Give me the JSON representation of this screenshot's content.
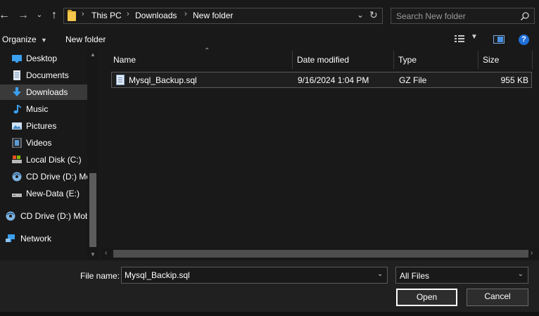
{
  "address": {
    "crumbs": [
      "This PC",
      "Downloads",
      "New folder"
    ],
    "search_placeholder": "Search New folder"
  },
  "toolbar": {
    "organize_label": "Organize",
    "new_folder_label": "New folder"
  },
  "nav": {
    "items": [
      {
        "label": "Desktop",
        "icon": "desktop-icon"
      },
      {
        "label": "Documents",
        "icon": "documents-icon"
      },
      {
        "label": "Downloads",
        "icon": "downloads-icon",
        "selected": true
      },
      {
        "label": "Music",
        "icon": "music-icon"
      },
      {
        "label": "Pictures",
        "icon": "pictures-icon"
      },
      {
        "label": "Videos",
        "icon": "videos-icon"
      },
      {
        "label": "Local Disk (C:)",
        "icon": "local-disk-icon"
      },
      {
        "label": "CD Drive (D:) Mo",
        "icon": "cd-drive-icon"
      },
      {
        "label": "New-Data (E:)",
        "icon": "drive-icon"
      },
      {
        "label": "CD Drive (D:) Mob",
        "icon": "cd-drive-icon"
      },
      {
        "label": "Network",
        "icon": "network-icon"
      }
    ]
  },
  "filelist": {
    "columns": [
      "Name",
      "Date modified",
      "Type",
      "Size"
    ],
    "rows": [
      {
        "name": "Mysql_Backup.sql",
        "date": "9/16/2024 1:04 PM",
        "type": "GZ File",
        "size": "955 KB"
      }
    ]
  },
  "bottom": {
    "file_name_label": "File name:",
    "file_name_value": "Mysql_Backip.sql",
    "file_type_value": "All Files",
    "open_label": "Open",
    "cancel_label": "Cancel"
  },
  "colors": {
    "background": "#191919",
    "selected": "#3a3a3a",
    "accent": "#1e6fd9"
  }
}
